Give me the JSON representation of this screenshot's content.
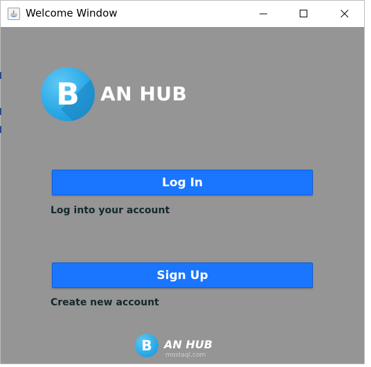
{
  "window": {
    "title": "Welcome Window",
    "controls": {
      "minimize_icon": "minimize-icon",
      "maximize_icon": "maximize-icon",
      "close_icon": "close-icon"
    }
  },
  "brand": {
    "logo_letter": "B",
    "name": "AN HUB"
  },
  "actions": {
    "login_label": "Log In",
    "login_caption": "Log into your account",
    "signup_label": "Sign Up",
    "signup_caption": "Create new account"
  },
  "watermark": {
    "letter": "B",
    "name": "AN HUB",
    "site": "mostaql.com"
  },
  "colors": {
    "background": "#959595",
    "button": "#1a75ff",
    "logo": "#2aa9e7",
    "caption": "#14282a"
  }
}
